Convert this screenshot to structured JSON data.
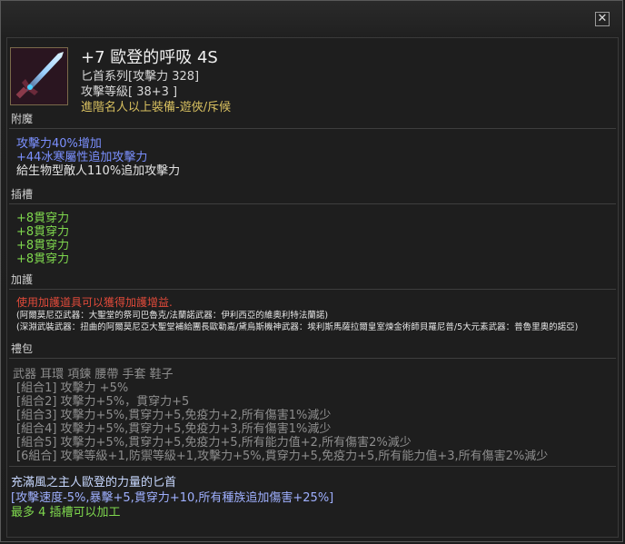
{
  "window": {
    "close_glyph": "✕"
  },
  "item": {
    "name": "+7 歐登的呼吸 4S",
    "category": "匕首系列[攻擊力 328]",
    "attack_level": "攻擊等級[ 38+3 ]",
    "requirement": "進階名人以上裝備-遊俠/斥候",
    "icon": "dagger-icon"
  },
  "sections": {
    "enchant": "附魔",
    "socket": "插槽",
    "protection": "加護",
    "gift": "禮包"
  },
  "enchant_lines": [
    "攻擊力40%增加",
    "+44冰寒屬性追加攻擊力",
    "給生物型敵人110%追加攻擊力"
  ],
  "socket_lines": [
    "+8貫穿力",
    "+8貫穿力",
    "+8貫穿力",
    "+8貫穿力"
  ],
  "protection": {
    "warning": "使用加護道具可以獲得加護增益.",
    "line1": "(阿爾莫尼亞武器：大聖堂的祭司巴魯克/法蘭諾武器：伊利西亞的維奧利特法蘭諾)",
    "line2": "(深淵武裝武器：扭曲的阿爾莫尼亞大聖堂補給團長歐勒嘉/黛烏斯機神武器：埃利斯馬薩拉爾皇室煉金術師貝羅尼普/5大元素武器：普魯里奧的諾亞)"
  },
  "gift": {
    "parts": "武器 耳環 項鍊 腰帶 手套 鞋子",
    "combos": [
      "[組合1] 攻擊力 +5%",
      "[組合2] 攻擊力+5%，貫穿力+5",
      "[組合3] 攻擊力+5%,貫穿力+5,免疫力+2,所有傷害1%減少",
      "[組合4] 攻擊力+5%,貫穿力+5,免疫力+3,所有傷害1%減少",
      "[組合5] 攻擊力+5%,貫穿力+5,免疫力+5,所有能力值+2,所有傷害2%減少",
      "[6組合] 攻擊等級+1,防禦等級+1,攻擊力+5%,貫穿力+5,免疫力+5,所有能力值+3,所有傷害2%減少"
    ]
  },
  "set_effect": {
    "title": "充滿風之主人歐登的力量的匕首",
    "bonus": "[攻擊速度-5%,暴擊+5,貫穿力+10,所有種族追加傷害+25%]",
    "slots": "最多 4 插槽可以加工"
  }
}
